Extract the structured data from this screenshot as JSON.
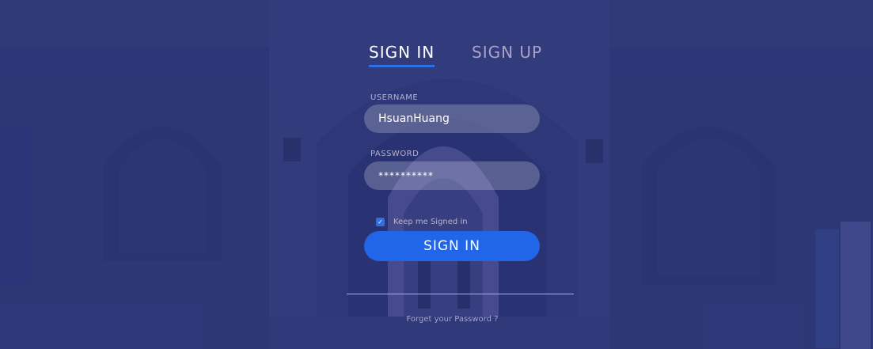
{
  "tabs": {
    "sign_in": "SIGN IN",
    "sign_up": "SIGN UP"
  },
  "form": {
    "username_label": "USERNAME",
    "username_value": "HsuanHuang",
    "password_label": "PASSWORD",
    "password_value": "**********",
    "keep_signed_in_label": "Keep me Signed in",
    "keep_signed_in_checked": true,
    "submit_label": "SIGN IN",
    "forgot_password": "Forget your Password ?"
  },
  "colors": {
    "accent": "#2166e8",
    "overlay": "#2d3570"
  }
}
